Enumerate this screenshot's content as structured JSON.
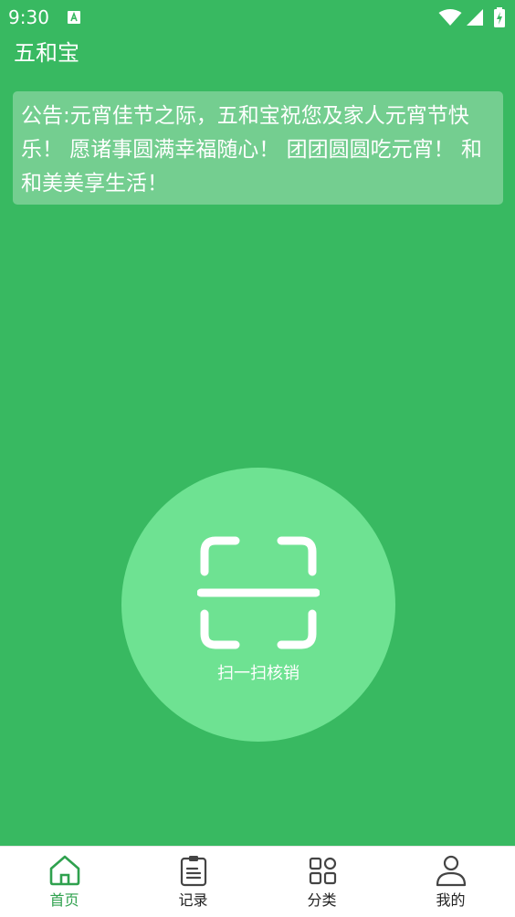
{
  "status_bar": {
    "time": "9:30",
    "notification_icon": "accessibility-a-icon",
    "icons": [
      "wifi-icon",
      "signal-icon",
      "battery-charging-icon"
    ]
  },
  "app": {
    "title": "五和宝",
    "background_color": "#38b961"
  },
  "notice": {
    "text": "公告:元宵佳节之际，五和宝祝您及家人元宵节快乐！ 愿诸事圆满幸福随心！ 团团圆圆吃元宵！ 和和美美享生活！"
  },
  "scan": {
    "label": "扫一扫核销",
    "icon": "scan-frame-icon",
    "circle_color": "#6ee292"
  },
  "bottom_nav": {
    "active_color": "#2fa14e",
    "items": [
      {
        "label": "首页",
        "icon": "home-icon",
        "active": true
      },
      {
        "label": "记录",
        "icon": "clipboard-icon",
        "active": false
      },
      {
        "label": "分类",
        "icon": "category-grid-icon",
        "active": false
      },
      {
        "label": "我的",
        "icon": "user-icon",
        "active": false
      }
    ]
  }
}
